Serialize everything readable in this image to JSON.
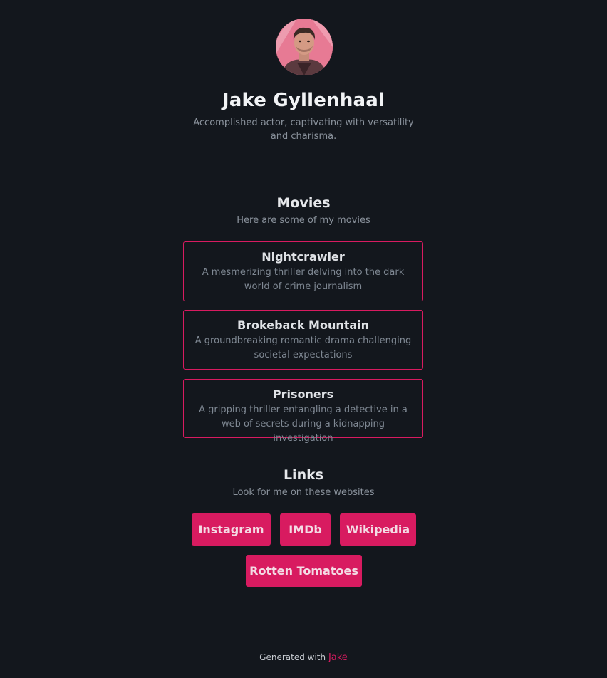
{
  "profile": {
    "name": "Jake Gyllenhaal",
    "bio": "Accomplished actor, captivating with versatility and charisma."
  },
  "movies": {
    "title": "Movies",
    "subtitle": "Here are some of my movies",
    "items": [
      {
        "title": "Nightcrawler",
        "description": "A mesmerizing thriller delving into the dark world of crime journalism"
      },
      {
        "title": "Brokeback Mountain",
        "description": "A groundbreaking romantic drama challenging societal expectations"
      },
      {
        "title": "Prisoners",
        "description": "A gripping thriller entangling a detective in a web of secrets during a kidnapping investigation"
      }
    ]
  },
  "links": {
    "title": "Links",
    "subtitle": "Look for me on these websites",
    "items": [
      {
        "label": "Instagram"
      },
      {
        "label": "IMDb"
      },
      {
        "label": "Wikipedia"
      },
      {
        "label": "Rotten Tomatoes"
      }
    ]
  },
  "footer": {
    "prefix": "Generated with",
    "brand": "Jake"
  },
  "colors": {
    "background": "#13171d",
    "accent": "#d81b60",
    "text": "#e6e8eb",
    "muted": "#8a929c"
  }
}
